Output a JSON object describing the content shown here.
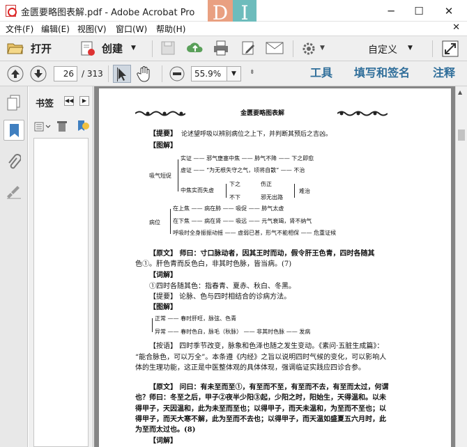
{
  "window": {
    "title": "金匮要略图表解.pdf - Adobe Acrobat Pro",
    "logo": [
      "D",
      "I"
    ],
    "min": "─",
    "max": "☐",
    "close": "✕"
  },
  "menu": [
    "文件(F)",
    "编辑(E)",
    "视图(V)",
    "窗口(W)",
    "帮助(H)"
  ],
  "toolbar": {
    "open": "打开",
    "create": "创建",
    "custom": "自定义"
  },
  "nav": {
    "page": "26",
    "total": "/ 313",
    "zoom": "55.9%"
  },
  "right_links": [
    "工具",
    "填写和签名",
    "注释"
  ],
  "bookmarks": {
    "title": "书签"
  },
  "doc": {
    "header": "金匮要略图表解",
    "r1": "【提要】",
    "r1t": "论述望呼吸以辨别病位之上下，并判断其预后之吉凶。",
    "r2": "【图解】",
    "g1": "实证 —— 邪气壅塞中焦 —— 肺气不降 —— 下之即愈",
    "g2": "虚证 —— “为无根失守之气，顷将自散” —— 不治",
    "g0": "吸气短促",
    "g3a": "中焦实而失虚",
    "g3b": "下之",
    "g3c": "伤正",
    "g3d": "不下",
    "g3e": "邪无出路",
    "g3f": "难治",
    "g4": "在上焦 —— 病在肺 —— 吸促 —— 肺气太虚",
    "g5": "在下焦 —— 病在肾 —— 吸远 —— 元气衰竭，肾不纳气",
    "g6": "呼吸时全身振振动摇 —— 虚弱已甚，形气不能相保 —— 危重证候",
    "g7": "病位",
    "p1a": "【原文】 师曰：寸口脉动者，因其王时而动，假令肝王色青，四时各随其",
    "p1b": "色①。肝色青而反色白，非其时色脉，皆当病。(7)",
    "p2": "【词解】",
    "p3": "①四时各随其色：指春青、夏赤、秋白、冬黑。",
    "p4": "【提要】 论脉、色与四时相结合的诊病方法。",
    "p5": "【图解】",
    "t1": "正常 —— 春时肝旺，脉弦、色青",
    "t2": "异常 —— 春时色白，脉毛（秋脉） —— 非其时色脉 —— 发病",
    "p6a": "【按语】 四时季节改变，脉象和色泽也随之发生变动。《素问·五脏生成篇》：",
    "p6b": "“能合脉色，可以万全”。本条遵《内经》之旨以说明四时气候的变化，可以影响人",
    "p6c": "体的生理功能，这正是中医整体观的具体体现，强调临证实践应四诊合参。",
    "p7a": "【原文】 问曰：有未至而至①，有至而不至，有至而不去，有至而太过，何谓",
    "p7b": "也？师曰：冬至之后，甲子②夜半少阳③起，少阳之时，阳始生，天得温和。以未",
    "p7c": "得甲子，天因温和，此为未至而至也；以得甲子，而天未温和，为至而不至也；以",
    "p7d": "得甲子，而天大寒不解，此为至而不去也；以得甲子，而天温如盛夏五六月时，此",
    "p7e": "为至而太过也。(8)",
    "p8": "【词解】"
  },
  "colors": {
    "accent": "#2f6e9a",
    "chrome": "#efefef",
    "doc_bg": "#858585"
  }
}
